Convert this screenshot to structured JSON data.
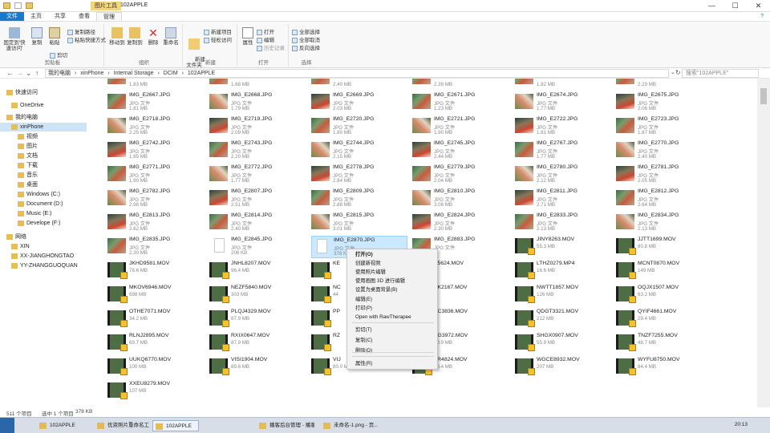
{
  "window": {
    "context_tab": "图片工具",
    "title": "102APPLE",
    "minimize": "—",
    "maximize": "☐",
    "close": "✕",
    "help": "?",
    "ribbon_toggle": "⌃"
  },
  "tabs": [
    "文件",
    "主页",
    "共享",
    "查看",
    "管理"
  ],
  "ribbon": {
    "pin_label": "固定到'快速访问'",
    "copy_label": "复制",
    "paste_label": "粘贴",
    "copy_path": "复制路径",
    "paste_shortcut": "粘贴快捷方式",
    "cut": "剪切",
    "clipboard_group": "剪贴板",
    "move_to": "移动到",
    "copy_to": "复制到",
    "delete": "删除",
    "rename": "重命名",
    "organize_group": "组织",
    "new_folder": "新建\n文件夹",
    "new_item": "新建项目",
    "easy_access": "轻松访问",
    "new_group": "新建",
    "properties": "属性",
    "open": "打开",
    "edit": "编辑",
    "history": "历史记录",
    "open_group": "打开",
    "select_all": "全部选择",
    "select_none": "全部取消",
    "invert": "反向选择",
    "select_group": "选择"
  },
  "address": {
    "back": "←",
    "forward": "→",
    "recent": "⌄",
    "up": "↑",
    "crumbs": [
      "我的电脑",
      "›",
      "xinPhone",
      "›",
      "Internal Storage",
      "›",
      "DCIM",
      "›",
      "102APPLE"
    ],
    "dropdown": "⌄",
    "refresh": "↻",
    "search_placeholder": "搜索\"102APPLE\""
  },
  "sidebar": [
    {
      "label": "快速访问",
      "icon": "star-icon"
    },
    {
      "label": "OneDrive",
      "icon": "cloud-icon"
    },
    {
      "label": "我的电脑",
      "icon": "computer-icon"
    },
    {
      "label": "xinPhone",
      "icon": "phone-icon",
      "selected": true
    },
    {
      "label": "视频",
      "icon": "video-folder-icon"
    },
    {
      "label": "图片",
      "icon": "picture-folder-icon"
    },
    {
      "label": "文档",
      "icon": "document-folder-icon"
    },
    {
      "label": "下载",
      "icon": "download-folder-icon"
    },
    {
      "label": "音乐",
      "icon": "music-folder-icon"
    },
    {
      "label": "桌面",
      "icon": "desktop-folder-icon"
    },
    {
      "label": "Windows (C:)",
      "icon": "drive-icon"
    },
    {
      "label": "Document (D:)",
      "icon": "drive-icon"
    },
    {
      "label": "Music (E:)",
      "icon": "drive-icon"
    },
    {
      "label": "Develope (F:)",
      "icon": "drive-icon"
    },
    {
      "label": "网络",
      "icon": "network-icon"
    },
    {
      "label": "XIN",
      "icon": "network-computer-icon"
    },
    {
      "label": "XX-JIANGHONGTAO",
      "icon": "network-computer-icon"
    },
    {
      "label": "YY-ZHANGGUOQUAN",
      "icon": "network-computer-icon"
    }
  ],
  "top_sizes": [
    "1.83 MB",
    "1.68 MB",
    "2.40 MB",
    "2.39 MB",
    "1.82 MB",
    "2.29 MB"
  ],
  "files": [
    [
      {
        "n": "IMG_E2667.JPG",
        "t": "JPG 文件",
        "s": "1.81 MB"
      },
      {
        "n": "IMG_E2668.JPG",
        "t": "JPG 文件",
        "s": "1.79 MB"
      },
      {
        "n": "IMG_E2669.JPG",
        "t": "JPG 文件",
        "s": "2.03 MB"
      },
      {
        "n": "IMG_E2671.JPG",
        "t": "JPG 文件",
        "s": "1.23 MB"
      },
      {
        "n": "IMG_E2674.JPG",
        "t": "JPG 文件",
        "s": "1.77 MB"
      },
      {
        "n": "IMG_E2675.JPG",
        "t": "JPG 文件",
        "s": "2.06 MB"
      }
    ],
    [
      {
        "n": "IMG_E2718.JPG",
        "t": "JPG 文件",
        "s": "2.25 MB"
      },
      {
        "n": "IMG_E2719.JPG",
        "t": "JPG 文件",
        "s": "2.09 MB"
      },
      {
        "n": "IMG_E2720.JPG",
        "t": "JPG 文件",
        "s": "1.80 MB"
      },
      {
        "n": "IMG_E2721.JPG",
        "t": "JPG 文件",
        "s": "1.90 MB"
      },
      {
        "n": "IMG_E2722.JPG",
        "t": "JPG 文件",
        "s": "1.81 MB"
      },
      {
        "n": "IMG_E2723.JPG",
        "t": "JPG 文件",
        "s": "1.87 MB"
      }
    ],
    [
      {
        "n": "IMG_E2742.JPG",
        "t": "JPG 文件",
        "s": "1.95 MB"
      },
      {
        "n": "IMG_E2743.JPG",
        "t": "JPG 文件",
        "s": "2.20 MB"
      },
      {
        "n": "IMG_E2744.JPG",
        "t": "JPG 文件",
        "s": "2.15 MB"
      },
      {
        "n": "IMG_E2745.JPG",
        "t": "JPG 文件",
        "s": "2.44 MB"
      },
      {
        "n": "IMG_E2767.JPG",
        "t": "JPG 文件",
        "s": "1.77 MB"
      },
      {
        "n": "IMG_E2770.JPG",
        "t": "JPG 文件",
        "s": "2.40 MB"
      }
    ],
    [
      {
        "n": "IMG_E2771.JPG",
        "t": "JPG 文件",
        "s": "1.90 MB"
      },
      {
        "n": "IMG_E2772.JPG",
        "t": "JPG 文件",
        "s": "1.77 MB"
      },
      {
        "n": "IMG_E2778.JPG",
        "t": "JPG 文件",
        "s": "2.84 MB"
      },
      {
        "n": "IMG_E2779.JPG",
        "t": "JPG 文件",
        "s": "2.04 MB"
      },
      {
        "n": "IMG_E2780.JPG",
        "t": "JPG 文件",
        "s": "2.12 MB"
      },
      {
        "n": "IMG_E2781.JPG",
        "t": "JPG 文件",
        "s": "2.05 MB"
      }
    ],
    [
      {
        "n": "IMG_E2782.JPG",
        "t": "JPG 文件",
        "s": "2.98 MB"
      },
      {
        "n": "IMG_E2807.JPG",
        "t": "JPG 文件",
        "s": "2.51 MB"
      },
      {
        "n": "IMG_E2809.JPG",
        "t": "JPG 文件",
        "s": "2.88 MB"
      },
      {
        "n": "IMG_E2810.JPG",
        "t": "JPG 文件",
        "s": "3.06 MB"
      },
      {
        "n": "IMG_E2811.JPG",
        "t": "JPG 文件",
        "s": "2.71 MB"
      },
      {
        "n": "IMG_E2812.JPG",
        "t": "JPG 文件",
        "s": "2.64 MB"
      }
    ],
    [
      {
        "n": "IMG_E2813.JPG",
        "t": "JPG 文件",
        "s": "2.62 MB"
      },
      {
        "n": "IMG_E2814.JPG",
        "t": "JPG 文件",
        "s": "2.40 MB"
      },
      {
        "n": "IMG_E2815.JPG",
        "t": "JPG 文件",
        "s": "3.01 MB"
      },
      {
        "n": "IMG_E2824.JPG",
        "t": "JPG 文件",
        "s": "2.30 MB"
      },
      {
        "n": "IMG_E2833.JPG",
        "t": "JPG 文件",
        "s": "2.13 MB"
      },
      {
        "n": "IMG_E2834.JPG",
        "t": "JPG 文件",
        "s": "2.13 MB"
      }
    ],
    [
      {
        "n": "IMG_E2835.JPG",
        "t": "JPG 文件",
        "s": "2.30 MB"
      },
      {
        "n": "IMG_E2845.JPG",
        "t": "JPG 文件",
        "s": "208 KB"
      },
      {
        "n": "IMG_E2870.JPG",
        "t": "JPG 文件",
        "s": "378 KB"
      },
      {
        "n": "IMG_E2883.JPG",
        "t": "JPG 文件",
        "s": ""
      },
      {
        "n": "JINY8263.MOV",
        "t": "",
        "s": "55.3 MB"
      },
      {
        "n": "JJTT1699.MOV",
        "t": "",
        "s": "80.8 MB"
      }
    ],
    [
      {
        "n": "JKHD9581.MOV",
        "t": "",
        "s": "78.6 MB"
      },
      {
        "n": "JNHL8207.MOV",
        "t": "",
        "s": "96.4 MB"
      },
      {
        "n": "KE",
        "t": "",
        "s": ""
      },
      {
        "n": "V5624.MOV",
        "t": "",
        "s": ""
      },
      {
        "n": "LTHZ0279.MP4",
        "t": "",
        "s": "16.6 MB"
      },
      {
        "n": "MCNT0870.MOV",
        "t": "",
        "s": "149 MB"
      }
    ],
    [
      {
        "n": "MKOV6946.MOV",
        "t": "",
        "s": "698 MB"
      },
      {
        "n": "NEZF5840.MOV",
        "t": "",
        "s": "303 MB"
      },
      {
        "n": "NC",
        "t": "",
        "s": "44"
      },
      {
        "n": "VK2167.MOV",
        "t": "",
        "s": ""
      },
      {
        "n": "NWTT1857.MOV",
        "t": "",
        "s": "126 MB"
      },
      {
        "n": "OQJX1507.MOV",
        "t": "",
        "s": "63.2 MB"
      }
    ],
    [
      {
        "n": "OTHE7071.MOV",
        "t": "",
        "s": "34.2 MB"
      },
      {
        "n": "PLQJ4329.MOV",
        "t": "",
        "s": "87.9 MB"
      },
      {
        "n": "PP",
        "t": "",
        "s": ""
      },
      {
        "n": "AC3836.MOV",
        "t": "",
        "s": ""
      },
      {
        "n": "QDGT3321.MOV",
        "t": "",
        "s": "212 MB"
      },
      {
        "n": "QYIF4661.MOV",
        "t": "",
        "s": "29.4 MB"
      }
    ],
    [
      {
        "n": "RLNJ2895.MOV",
        "t": "",
        "s": "69.7 MB"
      },
      {
        "n": "RXIX0647.MOV",
        "t": "",
        "s": "87.9 MB"
      },
      {
        "n": "RZ",
        "t": "",
        "s": ""
      },
      {
        "n": "SG3972.MOV",
        "t": "",
        "s": "60.9 MB"
      },
      {
        "n": "SHGX0907.MOV",
        "t": "",
        "s": "55.9 MB"
      },
      {
        "n": "TNZF7255.MOV",
        "t": "",
        "s": "48.7 MB"
      }
    ],
    [
      {
        "n": "UUKQ6770.MOV",
        "t": "",
        "s": "100 MB"
      },
      {
        "n": "VISI1904.MOV",
        "t": "",
        "s": "89.6 MB"
      },
      {
        "n": "VIJ",
        "t": "",
        "s": "80.0 MB"
      },
      {
        "n": "FR4824.MOV",
        "t": "",
        "s": "90.4 MB"
      },
      {
        "n": "WGCE8932.MOV",
        "t": "",
        "s": "207 MB"
      },
      {
        "n": "WYFU8750.MOV",
        "t": "",
        "s": "84.4 MB"
      }
    ],
    [
      {
        "n": "XXEU8279.MOV",
        "t": "",
        "s": "107 MB"
      }
    ]
  ],
  "context_menu": [
    "打开(O)",
    "创建新视频",
    "使用照片编辑",
    "使用画图 3D 进行编辑",
    "设置为桌面背景(B)",
    "编辑(E)",
    "打印(P)",
    "Open with RawTherapee",
    "复制(C)",
    "复制(C)",
    "剪切(T)",
    "删除(D)",
    "属性(R)"
  ],
  "status": {
    "count": "511 个项目",
    "selected": "选中 1 个项目",
    "size": "378 KB"
  },
  "taskbar": [
    {
      "label": "102APPLE"
    },
    {
      "label": "优资照片重命名工具"
    },
    {
      "label": "102APPLE",
      "active": true
    },
    {
      "label": "播客后台管理 - 播客..."
    },
    {
      "label": "未命名-1.png - 页..."
    }
  ],
  "clock": "20:13"
}
